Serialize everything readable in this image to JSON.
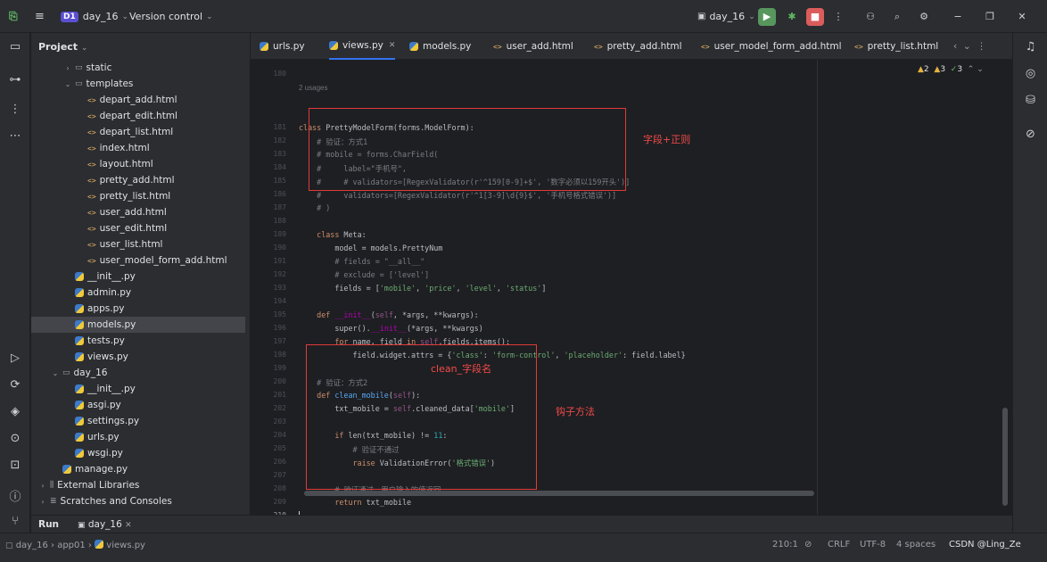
{
  "topbar": {
    "project_badge": "D1",
    "project": "day_16",
    "vcs": "Version control",
    "run_config": "day_16"
  },
  "project_panel": {
    "title": "Project"
  },
  "tree": [
    {
      "label": "static",
      "kind": "dir",
      "depth": 2,
      "arrow": "›"
    },
    {
      "label": "templates",
      "kind": "dir",
      "depth": 2,
      "arrow": "⌄"
    },
    {
      "label": "depart_add.html",
      "kind": "html",
      "depth": 3
    },
    {
      "label": "depart_edit.html",
      "kind": "html",
      "depth": 3
    },
    {
      "label": "depart_list.html",
      "kind": "html",
      "depth": 3
    },
    {
      "label": "index.html",
      "kind": "html",
      "depth": 3
    },
    {
      "label": "layout.html",
      "kind": "html",
      "depth": 3
    },
    {
      "label": "pretty_add.html",
      "kind": "html",
      "depth": 3
    },
    {
      "label": "pretty_list.html",
      "kind": "html",
      "depth": 3
    },
    {
      "label": "user_add.html",
      "kind": "html",
      "depth": 3
    },
    {
      "label": "user_edit.html",
      "kind": "html",
      "depth": 3
    },
    {
      "label": "user_list.html",
      "kind": "html",
      "depth": 3
    },
    {
      "label": "user_model_form_add.html",
      "kind": "html",
      "depth": 3
    },
    {
      "label": "__init__.py",
      "kind": "py",
      "depth": 2
    },
    {
      "label": "admin.py",
      "kind": "py",
      "depth": 2
    },
    {
      "label": "apps.py",
      "kind": "py",
      "depth": 2
    },
    {
      "label": "models.py",
      "kind": "py",
      "depth": 2,
      "selected": true
    },
    {
      "label": "tests.py",
      "kind": "py",
      "depth": 2
    },
    {
      "label": "views.py",
      "kind": "py",
      "depth": 2
    },
    {
      "label": "day_16",
      "kind": "dir",
      "depth": 1,
      "arrow": "⌄"
    },
    {
      "label": "__init__.py",
      "kind": "py",
      "depth": 2
    },
    {
      "label": "asgi.py",
      "kind": "py",
      "depth": 2
    },
    {
      "label": "settings.py",
      "kind": "py",
      "depth": 2
    },
    {
      "label": "urls.py",
      "kind": "py",
      "depth": 2
    },
    {
      "label": "wsgi.py",
      "kind": "py",
      "depth": 2
    },
    {
      "label": "manage.py",
      "kind": "py",
      "depth": 1
    },
    {
      "label": "External Libraries",
      "kind": "lib",
      "depth": 0,
      "arrow": "›"
    },
    {
      "label": "Scratches and Consoles",
      "kind": "scratch",
      "depth": 0,
      "arrow": "›"
    }
  ],
  "tabs": [
    {
      "label": "urls.py",
      "kind": "py"
    },
    {
      "label": "views.py",
      "kind": "py",
      "active": true
    },
    {
      "label": "models.py",
      "kind": "py"
    },
    {
      "label": "user_add.html",
      "kind": "html"
    },
    {
      "label": "pretty_add.html",
      "kind": "html"
    },
    {
      "label": "user_model_form_add.html",
      "kind": "html"
    },
    {
      "label": "pretty_list.html",
      "kind": "html"
    }
  ],
  "inspections": {
    "warn1": "2",
    "warn2": "3",
    "ok": "3"
  },
  "usages": "2 usages",
  "line_numbers": [
    "180",
    "181",
    "182",
    "183",
    "184",
    "185",
    "186",
    "187",
    "188",
    "189",
    "190",
    "191",
    "192",
    "193",
    "194",
    "195",
    "196",
    "197",
    "198",
    "199",
    "200",
    "201",
    "202",
    "203",
    "204",
    "205",
    "206",
    "207",
    "208",
    "209",
    "210"
  ],
  "code": [
    [],
    [
      [
        "kw",
        "class "
      ],
      [
        "",
        "PrettyModelForm(forms.ModelForm):"
      ]
    ],
    [
      [
        "cmt",
        "    # 验证：方式1"
      ]
    ],
    [
      [
        "cmt",
        "    # mobile = forms.CharField("
      ]
    ],
    [
      [
        "cmt",
        "    #     label=\"手机号\","
      ]
    ],
    [
      [
        "cmt",
        "    #     # validators=[RegexValidator(r'^159[0-9]+$', '数字必须以159开头')]"
      ]
    ],
    [
      [
        "cmt",
        "    #     validators=[RegexValidator(r'^1[3-9]\\d{9}$', '手机号格式错误')]"
      ]
    ],
    [
      [
        "cmt",
        "    # )"
      ]
    ],
    [],
    [
      [
        "kw",
        "    class "
      ],
      [
        "",
        "Meta:"
      ]
    ],
    [
      [
        "",
        "        model = models.PrettyNum"
      ]
    ],
    [
      [
        "cmt",
        "        # fields = \"__all__\""
      ]
    ],
    [
      [
        "cmt",
        "        # exclude = ['level']"
      ]
    ],
    [
      [
        "",
        "        fields = ["
      ],
      [
        "str",
        "'mobile'"
      ],
      [
        "",
        ", "
      ],
      [
        "str",
        "'price'"
      ],
      [
        "",
        ", "
      ],
      [
        "str",
        "'level'"
      ],
      [
        "",
        ", "
      ],
      [
        "str",
        "'status'"
      ],
      [
        "",
        "]"
      ]
    ],
    [],
    [
      [
        "kw",
        "    def "
      ],
      [
        "dunder",
        "__init__"
      ],
      [
        "",
        "("
      ],
      [
        "slf",
        "self"
      ],
      [
        "",
        ", *args, **kwargs):"
      ]
    ],
    [
      [
        "",
        "        super()."
      ],
      [
        "dunder",
        "__init__"
      ],
      [
        "",
        "(*args, **kwargs)"
      ]
    ],
    [
      [
        "kw",
        "        for "
      ],
      [
        "",
        "name, field "
      ],
      [
        "kw",
        "in "
      ],
      [
        "slf",
        "self"
      ],
      [
        "",
        ".fields.items():"
      ]
    ],
    [
      [
        "",
        "            field.widget.attrs = {"
      ],
      [
        "str",
        "'class'"
      ],
      [
        "",
        ": "
      ],
      [
        "str",
        "'form-control'"
      ],
      [
        "",
        ", "
      ],
      [
        "str",
        "'placeholder'"
      ],
      [
        "",
        ": field.label}"
      ]
    ],
    [],
    [
      [
        "cmt",
        "    # 验证：方式2"
      ]
    ],
    [
      [
        "kw",
        "    def "
      ],
      [
        "fn",
        "clean_mobile"
      ],
      [
        "",
        "("
      ],
      [
        "slf",
        "self"
      ],
      [
        "",
        "):"
      ]
    ],
    [
      [
        "",
        "        txt_mobile = "
      ],
      [
        "slf",
        "self"
      ],
      [
        "",
        ".cleaned_data["
      ],
      [
        "str",
        "'mobile'"
      ],
      [
        "",
        "]"
      ]
    ],
    [],
    [
      [
        "kw",
        "        if "
      ],
      [
        "",
        "len(txt_mobile) != "
      ],
      [
        "num",
        "11"
      ],
      [
        "",
        ":"
      ]
    ],
    [
      [
        "cmt",
        "            # 验证不通过"
      ]
    ],
    [
      [
        "kw",
        "            raise "
      ],
      [
        "",
        "ValidationError("
      ],
      [
        "str",
        "'格式错误'"
      ],
      [
        "",
        ")"
      ]
    ],
    [],
    [
      [
        "cmt",
        "        # 验证通过，用户输入的值返回"
      ]
    ],
    [
      [
        "kw",
        "        return "
      ],
      [
        "",
        "txt_mobile"
      ]
    ],
    []
  ],
  "annotations": {
    "a1": "字段+正则",
    "a2": "clean_字段名",
    "a3": "钩子方法"
  },
  "run": {
    "label": "Run",
    "config": "day_16"
  },
  "status": {
    "crumb1": "day_16",
    "crumb2": "app01",
    "crumb3": "views.py",
    "pos": "210:1",
    "le": "CRLF",
    "enc": "UTF-8",
    "indent": "4 spaces",
    "watermark": "CSDN @Ling_Ze"
  }
}
